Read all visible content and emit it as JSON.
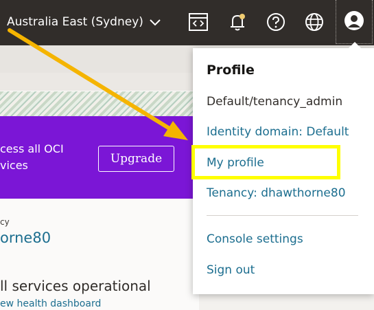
{
  "topbar": {
    "region_label": "Australia East (Sydney)",
    "icons": [
      "code-editor-icon",
      "bell-icon",
      "help-icon",
      "globe-icon",
      "user-avatar-icon"
    ]
  },
  "background": {
    "promo_text_line1": "cess all OCI",
    "promo_text_line2": "vices",
    "upgrade_label": "Upgrade",
    "tenancy_label": "cy",
    "tenancy_name": "orne80",
    "services_status": "ll services operational",
    "health_link": "ew health dashboard"
  },
  "profile_menu": {
    "title": "Profile",
    "user": "Default/tenancy_admin",
    "identity_domain": "Identity domain: Default",
    "my_profile": "My profile",
    "tenancy": "Tenancy: dhawthorne80",
    "console_settings": "Console settings",
    "sign_out": "Sign out"
  },
  "colors": {
    "topbar": "#312d2a",
    "promo": "#7b16d6",
    "link": "#1c6e8f",
    "highlight": "#ffff00",
    "arrow": "#f5b400",
    "notification_dot": "#f0cc71"
  }
}
